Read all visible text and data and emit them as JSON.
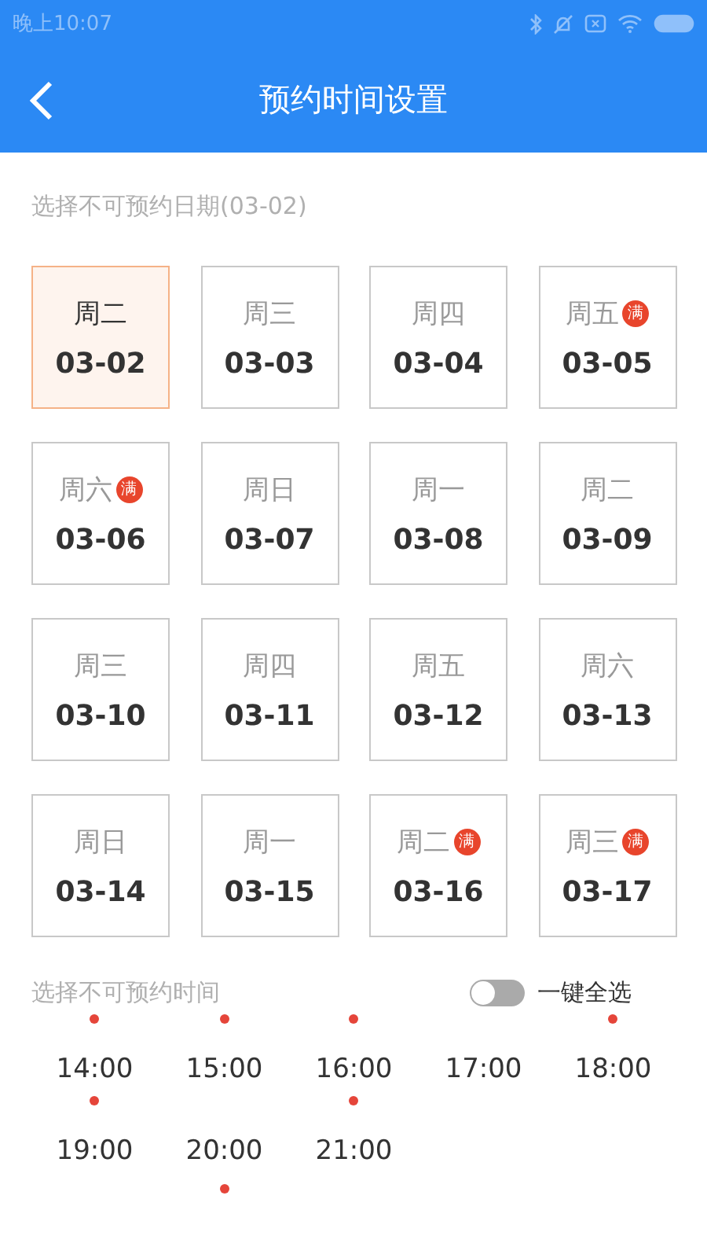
{
  "status_bar": {
    "time": "晚上10:07"
  },
  "header": {
    "title": "预约时间设置"
  },
  "date_section": {
    "label": "选择不可预约日期(03-02)"
  },
  "days": [
    {
      "weekday": "周二",
      "date": "03-02",
      "selected": true
    },
    {
      "weekday": "周三",
      "date": "03-03",
      "selected": false
    },
    {
      "weekday": "周四",
      "date": "03-04",
      "selected": false
    },
    {
      "weekday": "周五",
      "date": "03-05",
      "selected": false,
      "badge": "满"
    },
    {
      "weekday": "周六",
      "date": "03-06",
      "selected": false,
      "badge": "满"
    },
    {
      "weekday": "周日",
      "date": "03-07",
      "selected": false
    },
    {
      "weekday": "周一",
      "date": "03-08",
      "selected": false
    },
    {
      "weekday": "周二",
      "date": "03-09",
      "selected": false
    },
    {
      "weekday": "周三",
      "date": "03-10",
      "selected": false
    },
    {
      "weekday": "周四",
      "date": "03-11",
      "selected": false
    },
    {
      "weekday": "周五",
      "date": "03-12",
      "selected": false
    },
    {
      "weekday": "周六",
      "date": "03-13",
      "selected": false
    },
    {
      "weekday": "周日",
      "date": "03-14",
      "selected": false
    },
    {
      "weekday": "周一",
      "date": "03-15",
      "selected": false
    },
    {
      "weekday": "周二",
      "date": "03-16",
      "selected": false,
      "badge": "满"
    },
    {
      "weekday": "周三",
      "date": "03-17",
      "selected": false,
      "badge": "满"
    }
  ],
  "time_section": {
    "label": "选择不可预约时间",
    "select_all": {
      "label": "一键全选",
      "on": false
    }
  },
  "times": [
    {
      "time": "14:00",
      "dot_above": true,
      "dot_below": false
    },
    {
      "time": "15:00",
      "dot_above": true,
      "dot_below": false
    },
    {
      "time": "16:00",
      "dot_above": true,
      "dot_below": false
    },
    {
      "time": "17:00",
      "dot_above": false,
      "dot_below": false
    },
    {
      "time": "18:00",
      "dot_above": true,
      "dot_below": false
    },
    {
      "time": "19:00",
      "dot_above": true,
      "dot_below": false
    },
    {
      "time": "20:00",
      "dot_above": false,
      "dot_below": true
    },
    {
      "time": "21:00",
      "dot_above": true,
      "dot_below": false
    }
  ]
}
